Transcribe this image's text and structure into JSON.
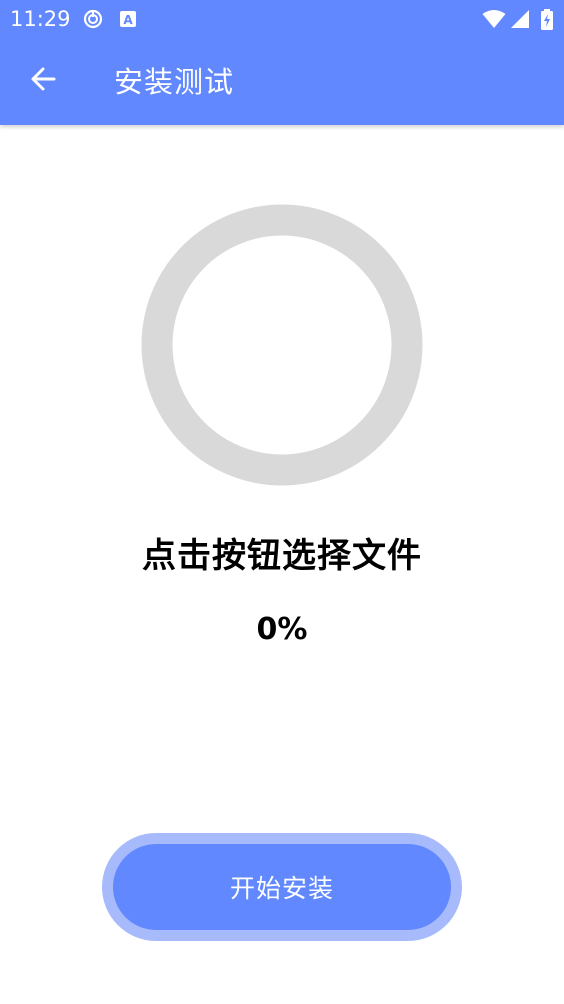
{
  "status_bar": {
    "time": "11:29",
    "left_icons": [
      "sync-notification-icon",
      "text-a-notification-icon"
    ],
    "right_icons": [
      "wifi-icon",
      "cell-signal-icon",
      "battery-charging-icon"
    ]
  },
  "app_bar": {
    "back_icon": "arrow-left-icon",
    "title": "安装测试"
  },
  "progress": {
    "value": 0,
    "track_color": "#d9d9d9",
    "fill_color": "#6188fe"
  },
  "main": {
    "message": "点击按钮选择文件",
    "percent_label": "0%"
  },
  "actions": {
    "start_label": "开始安装"
  },
  "colors": {
    "primary": "#6188fe",
    "primary_light": "#a7bbfc",
    "background": "#ffffff",
    "text": "#000000"
  }
}
